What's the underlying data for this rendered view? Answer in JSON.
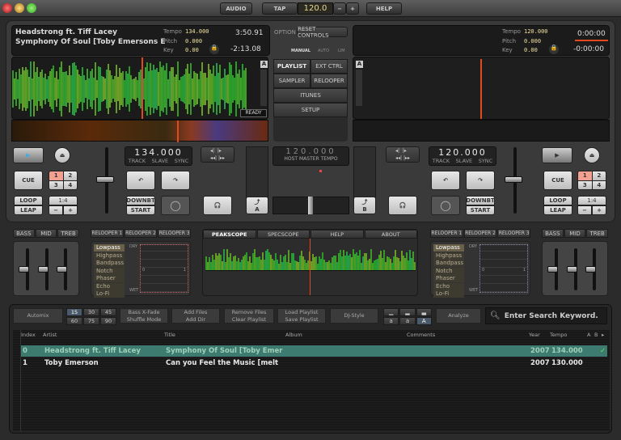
{
  "titlebar": {
    "audio": "AUDIO",
    "tap": "TAP",
    "tempo": "120.0",
    "minus": "−",
    "plus": "+",
    "help": "HELP"
  },
  "deck_a": {
    "artist": "Headstrong ft. Tiff Lacey",
    "title": "Symphony Of Soul [Toby Emersons E",
    "tempo_label": "Tempo",
    "tempo": "134.000",
    "pitch_label": "Pitch",
    "pitch": "0.000",
    "key_label": "Key",
    "key": "0.00",
    "elapsed": "3:50.91",
    "remaining": "-2:13.08",
    "status": "READY",
    "badge": "A",
    "bpm": "134.000",
    "track": "TRACK",
    "slave": "SLAVE",
    "sync": "SYNC",
    "cue": "CUE",
    "loop": "LOOP",
    "leap": "LEAP",
    "downbt": "DOWNBT",
    "start": "START",
    "hotcues": [
      "1",
      "2",
      "3",
      "4"
    ],
    "loop_len": "1:4",
    "minus": "−",
    "plus": "+",
    "xfader_label": "A"
  },
  "deck_b": {
    "tempo_label": "Tempo",
    "tempo": "120.000",
    "pitch_label": "Pitch",
    "pitch": "0.000",
    "key_label": "Key",
    "key": "0.00",
    "elapsed": "0:00:00",
    "remaining": "-0:00:00",
    "badge": "A",
    "bpm": "120.000",
    "track": "TRACK",
    "slave": "SLAVE",
    "sync": "SYNC",
    "cue": "CUE",
    "loop": "LOOP",
    "leap": "LEAP",
    "downbt": "DOWNBT",
    "start": "START",
    "hotcues": [
      "1",
      "2",
      "3",
      "4"
    ],
    "loop_len": "1:4",
    "minus": "−",
    "plus": "+",
    "xfader_label": "B"
  },
  "center": {
    "option": "OPTION",
    "reset": "RESET CONTROLS",
    "modes": [
      "MANUAL",
      "AUTO",
      "LIM"
    ],
    "playlist": "PLAYLIST",
    "ext_ctrl": "EXT CTRL",
    "sampler": "SAMPLER",
    "relooper": "RELOOPER",
    "itunes": "ITUNES",
    "setup": "SETUP",
    "host_tempo": "120.000",
    "host_label": "HOST MASTER TEMPO"
  },
  "eq": {
    "bass": "BASS",
    "mid": "MID",
    "treb": "TREB"
  },
  "relooper": {
    "tabs": [
      "RELOOPER 1",
      "RELOOPER 2",
      "RELOOPER 3"
    ],
    "effects": [
      "Lowpass",
      "Highpass",
      "Bandpass",
      "Notch",
      "Phaser",
      "Echo",
      "Lo-Fi"
    ],
    "dry": "DRY",
    "wet": "WET",
    "zero": "0",
    "one": "1"
  },
  "scope": {
    "tabs": [
      "PEAKSCOPE",
      "SPECSCOPE",
      "HELP",
      "ABOUT"
    ]
  },
  "playlist": {
    "automix": "Automix",
    "times": [
      "15",
      "30",
      "45",
      "60",
      "75",
      "90"
    ],
    "bass_xfade": "Bass X-Fade",
    "shuffle": "Shuffle Mode",
    "add_files": "Add Files",
    "add_dir": "Add Dir",
    "remove_files": "Remove Files",
    "clear_playlist": "Clear Playlist",
    "load_playlist": "Load Playlist",
    "save_playlist": "Save Playlist",
    "dj_style": "DJ-Style",
    "size_labels": [
      "a",
      "a",
      "A"
    ],
    "analyze": "Analyze",
    "search_placeholder": "Enter Search Keyword.",
    "columns": [
      "Index",
      "Artist",
      "Title",
      "Album",
      "Comments",
      "Year",
      "Tempo",
      "A",
      "B"
    ],
    "rows": [
      {
        "index": "0",
        "artist": "Headstrong ft. Tiff Lacey",
        "title": "Symphony Of Soul [Toby Emer",
        "album": "",
        "comments": "",
        "year": "2007",
        "tempo": "134.000",
        "selected": true,
        "b": "✓"
      },
      {
        "index": "1",
        "artist": "Toby Emerson",
        "title": "Can you Feel the Music [melt",
        "album": "",
        "comments": "",
        "year": "2007",
        "tempo": "130.000",
        "selected": false,
        "b": ""
      }
    ]
  },
  "colors": {
    "accent": "#e04a1e",
    "selected_row": "#3d7a70",
    "waveform": "#5fa62a"
  }
}
